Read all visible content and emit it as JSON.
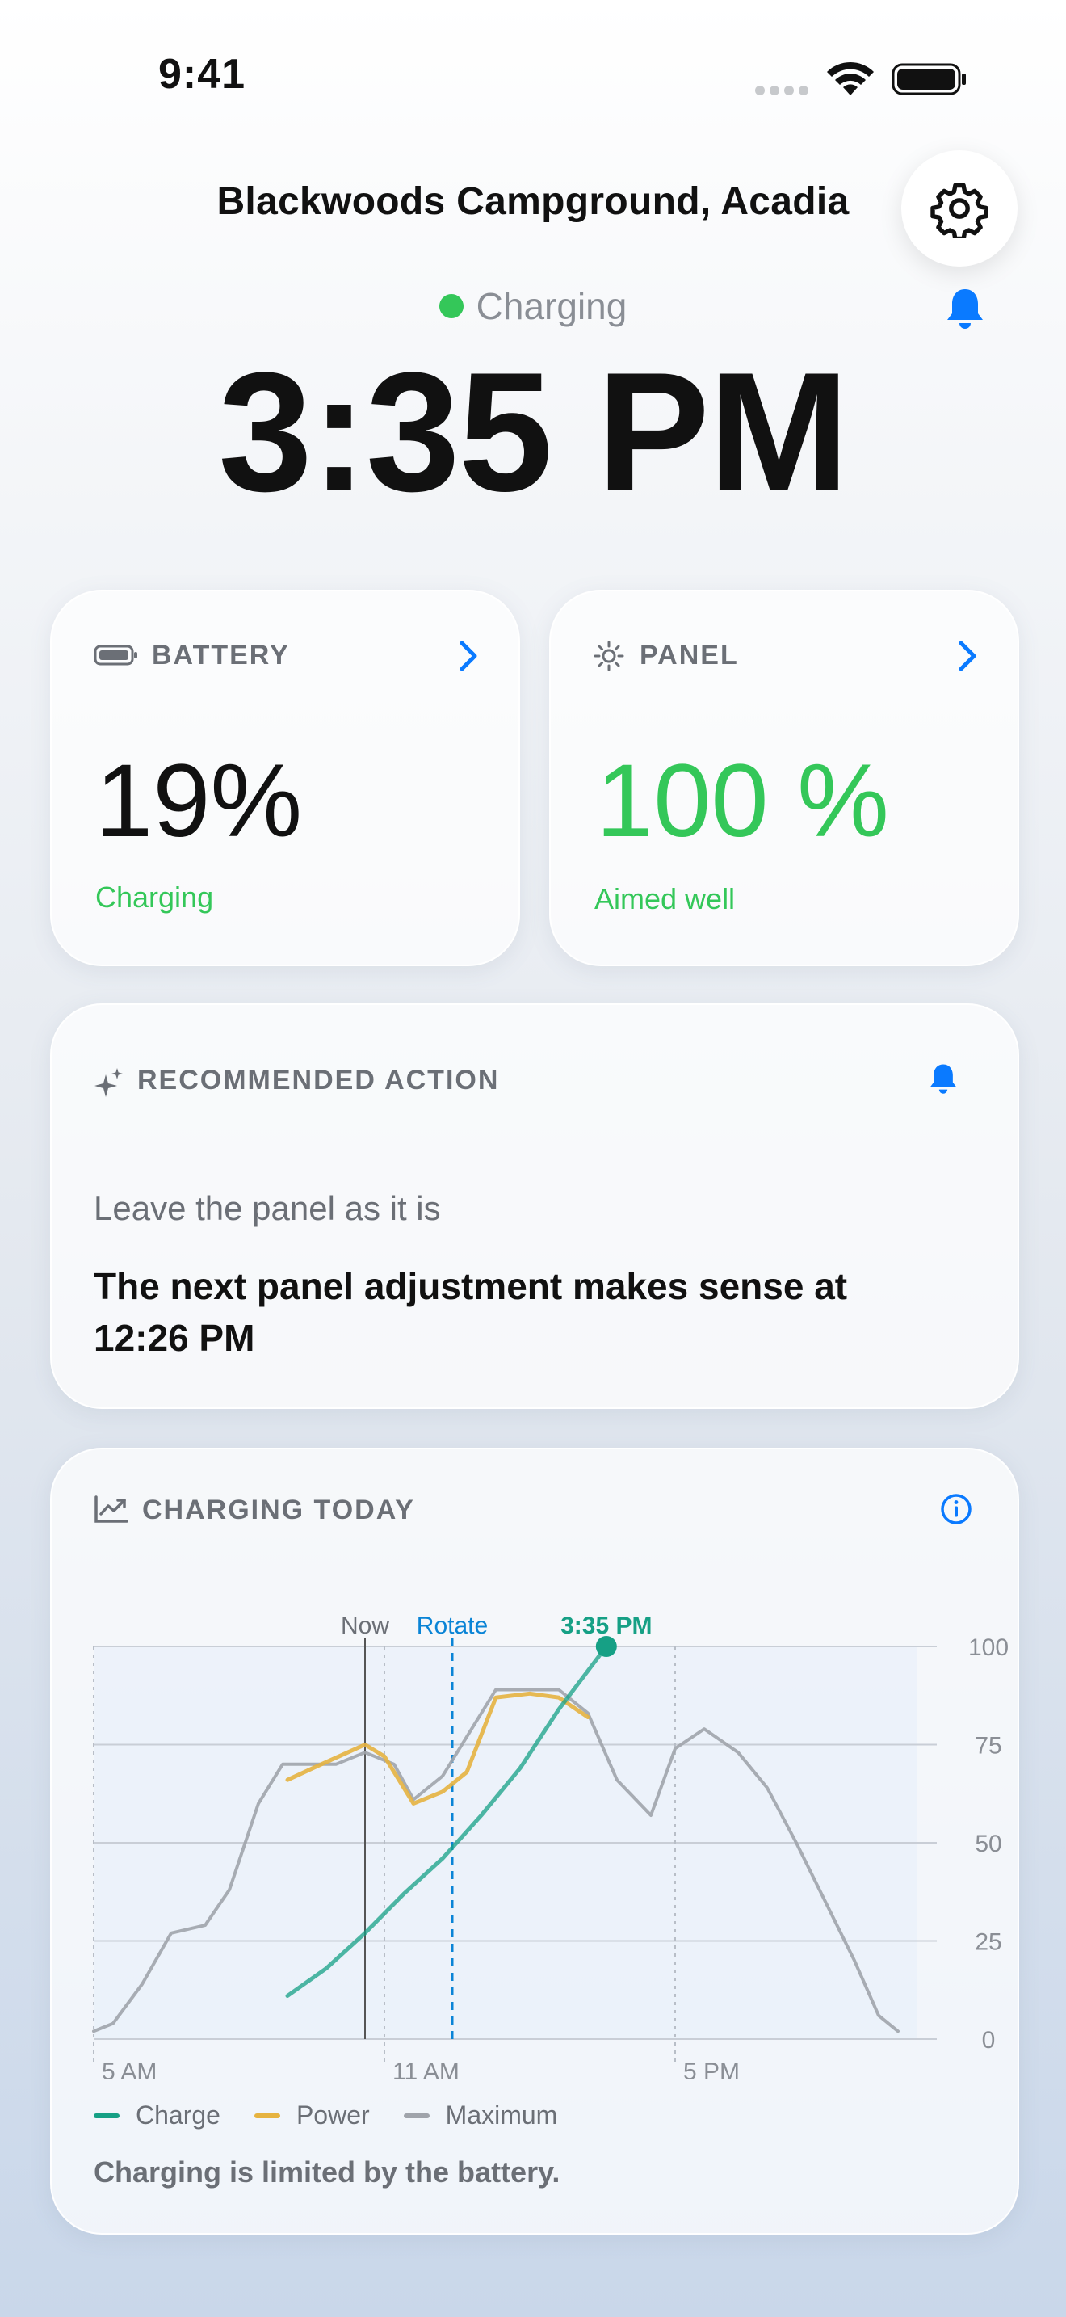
{
  "status_bar": {
    "time": "9:41"
  },
  "header": {
    "location": "Blackwoods Campground, Acadia",
    "status": "Charging",
    "time": "3:35 PM"
  },
  "icons": [
    "gear-icon",
    "bell-icon",
    "battery-icon",
    "sun-icon",
    "sparkle-icon",
    "chart-icon",
    "info-icon",
    "chevron-right-icon"
  ],
  "colors": {
    "green": "#34c759",
    "blue": "#0a7aff",
    "teal": "#16a085",
    "orange": "#e6b340",
    "gray": "#9a9ea5"
  },
  "battery_card": {
    "label": "BATTERY",
    "value": "19%",
    "status": "Charging"
  },
  "panel_card": {
    "label": "PANEL",
    "value": "100 %",
    "status": "Aimed well"
  },
  "recommended": {
    "label": "RECOMMENDED ACTION",
    "text": "Leave the panel as it is",
    "next_line1": "The next panel adjustment makes sense at",
    "next_line2": "12:26 PM"
  },
  "charging_today": {
    "label": "CHARGING TODAY",
    "footer": "Charging is limited by the battery."
  },
  "chart_data": {
    "type": "line",
    "x_ticks": [
      {
        "hour": 5,
        "label": "5 AM"
      },
      {
        "hour": 11,
        "label": "11 AM"
      },
      {
        "hour": 17,
        "label": "5 PM"
      }
    ],
    "ylim": [
      0,
      100
    ],
    "y_ticks": [
      0,
      25,
      50,
      75,
      100
    ],
    "xlim": [
      5,
      22
    ],
    "markers": [
      {
        "hour": 10.6,
        "label": "Now",
        "style": "solid",
        "color": "#555555"
      },
      {
        "hour": 12.4,
        "label": "Rotate",
        "style": "dashed",
        "color": "#0a84d6"
      },
      {
        "hour": 15.58,
        "label": "3:35 PM",
        "style": "point",
        "color": "#16a085",
        "y": 100
      }
    ],
    "series": [
      {
        "name": "Charge",
        "color": "#16a085",
        "x": [
          9.0,
          9.8,
          10.6,
          11.4,
          12.2,
          13.0,
          13.8,
          14.6,
          15.58
        ],
        "y": [
          11,
          18,
          27,
          37,
          46,
          57,
          69,
          84,
          100
        ]
      },
      {
        "name": "Power",
        "color": "#e6b340",
        "x": [
          9.0,
          9.7,
          10.6,
          11.0,
          11.6,
          12.2,
          12.7,
          13.3,
          14.0,
          14.6,
          15.2
        ],
        "y": [
          66,
          70,
          75,
          72,
          60,
          63,
          68,
          87,
          88,
          87,
          82
        ]
      },
      {
        "name": "Maximum",
        "color": "#a0a4ab",
        "x": [
          5,
          5.4,
          6.0,
          6.6,
          7.3,
          7.8,
          8.4,
          8.9,
          9.5,
          10.0,
          10.6,
          11.2,
          11.6,
          12.2,
          12.8,
          13.3,
          14.0,
          14.6,
          15.2,
          15.8,
          16.5,
          17.0,
          17.6,
          18.3,
          18.9,
          19.5,
          20.1,
          20.7,
          21.2,
          21.6
        ],
        "y": [
          2,
          4,
          14,
          27,
          29,
          38,
          60,
          70,
          70,
          70,
          73,
          70,
          61,
          67,
          79,
          89,
          89,
          89,
          83,
          66,
          57,
          74,
          79,
          73,
          64,
          50,
          35,
          20,
          6,
          2
        ]
      }
    ],
    "legend_position": "bottom-left",
    "grid": true
  }
}
